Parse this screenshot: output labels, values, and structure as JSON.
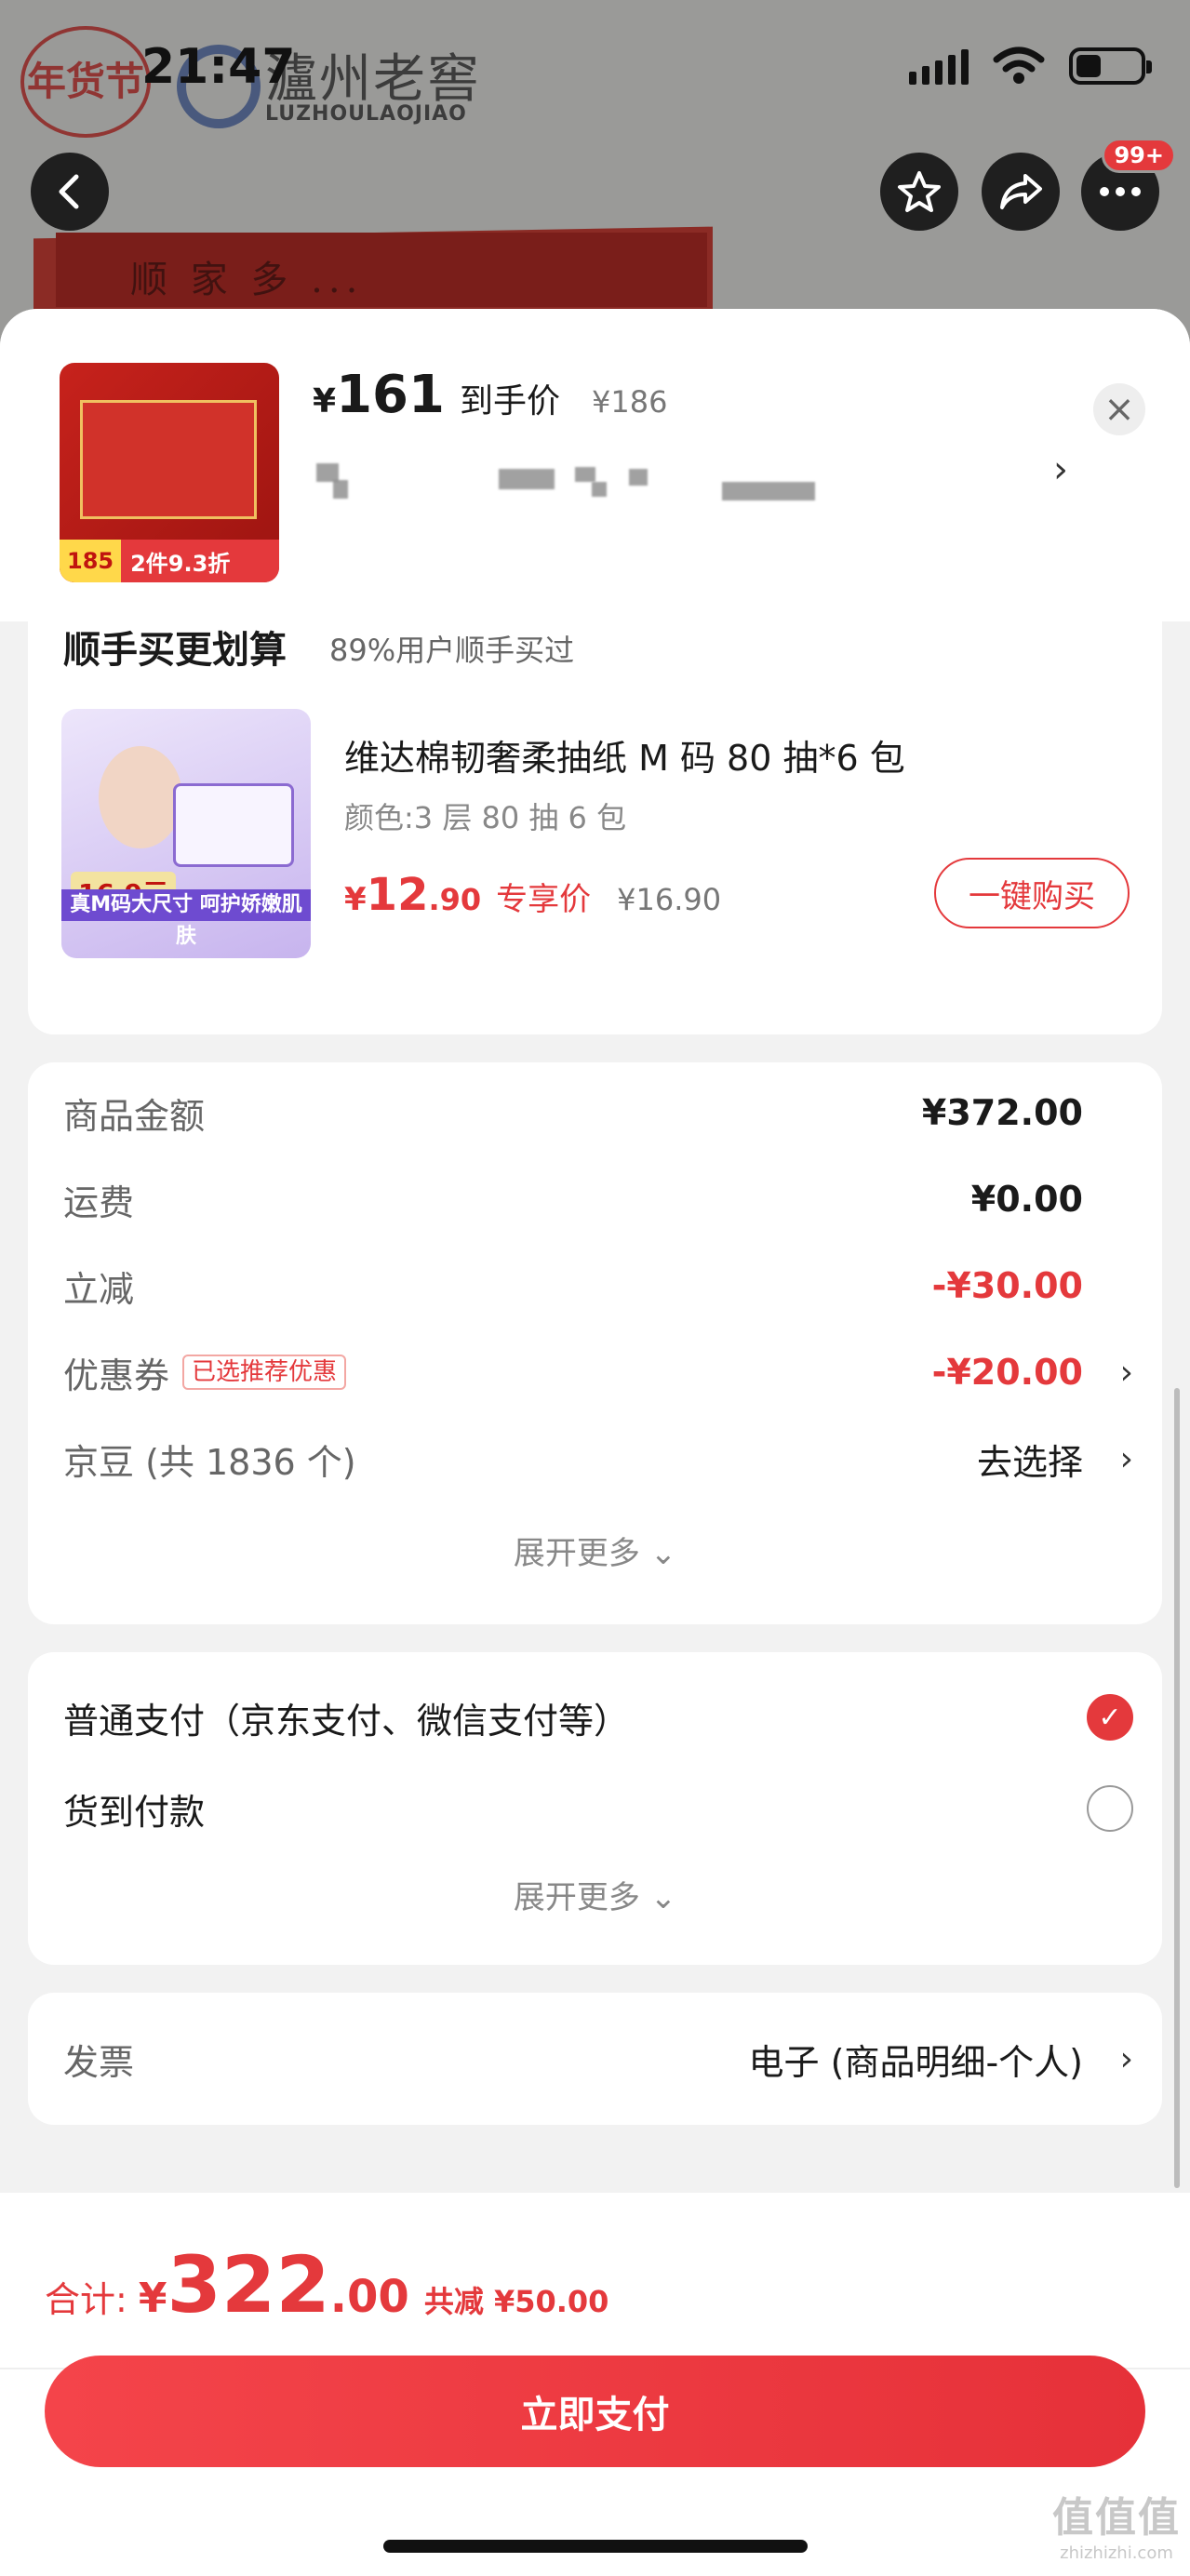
{
  "status_bar": {
    "time": "21:47"
  },
  "brand": {
    "seal": "年货节",
    "name_cn": "瀘州老窖",
    "name_en": "LUZHOULAOJIAO",
    "box_text": "顺 家 多 ..."
  },
  "top_actions": {
    "badge": "99+"
  },
  "order_head": {
    "currency": "¥",
    "price": "161",
    "price_label": "到手价",
    "original_price": "¥186",
    "thumb_price": "185",
    "thumb_deal": "2件9.3折",
    "close_icon": "×",
    "chevron": "›"
  },
  "upsell": {
    "title": "顺手买更划算",
    "subtitle": "89%用户顺手买过",
    "product_name": "维达棉韧奢柔抽纸 M 码 80 抽*6 包",
    "spec": "颜色:3 层 80 抽 6 包",
    "price_currency": "¥",
    "price_int": "12",
    "price_dec": ".90",
    "price_label": "专享价",
    "original_price": "¥16.90",
    "buy_button": "一键购买",
    "img_tag": "16.9元",
    "img_strip": "真M码大尺寸 呵护娇嫩肌肤"
  },
  "amounts": {
    "rows": [
      {
        "label": "商品金额",
        "value": "¥372.00"
      },
      {
        "label": "运费",
        "value": "¥0.00"
      },
      {
        "label": "立减",
        "value": "-¥30.00"
      },
      {
        "label": "优惠券",
        "tag": "已选推荐优惠",
        "value": "-¥20.00"
      },
      {
        "label": "京豆 (共 1836 个)",
        "value": "去选择"
      }
    ],
    "more": "展开更多 ⌄"
  },
  "payment": {
    "options": [
      {
        "label": "普通支付（京东支付、微信支付等）",
        "selected": true
      },
      {
        "label": "货到付款",
        "selected": false
      }
    ],
    "more": "展开更多 ⌄"
  },
  "invoice": {
    "label": "发票",
    "value": "电子 (商品明细-个人)"
  },
  "footer": {
    "total_label": "合计:",
    "currency": "¥",
    "total_int": "322",
    "total_dec": ".00",
    "saved": "共减 ¥50.00",
    "pay_button": "立即支付"
  },
  "watermark": {
    "cn": "值值值",
    "url": "zhizhizhi.com"
  },
  "colors": {
    "accent": "#e4393c",
    "sheet_bg": "#f2f2f2"
  },
  "icons": [
    "back-icon",
    "star-icon",
    "share-icon",
    "more-icon",
    "close-icon",
    "chevron-right-icon",
    "check-icon",
    "wifi-icon",
    "signal-icon",
    "battery-icon"
  ]
}
